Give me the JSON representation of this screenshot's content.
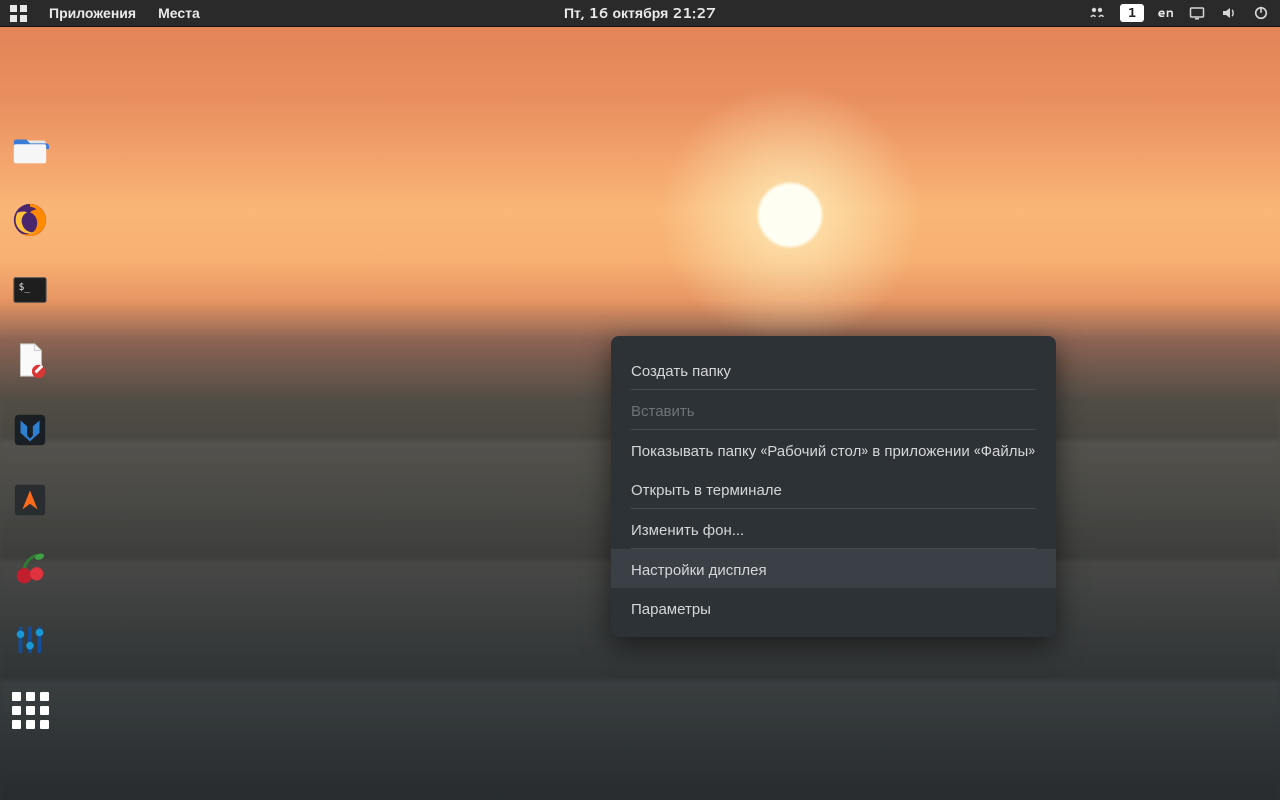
{
  "topbar": {
    "applications": "Приложения",
    "places": "Места",
    "datetime": "Пт, 16 октября  21:27",
    "workspace": "1",
    "keyboard_layout": "en"
  },
  "dock": {
    "items": [
      {
        "name": "files-app-icon"
      },
      {
        "name": "firefox-icon"
      },
      {
        "name": "terminal-icon"
      },
      {
        "name": "text-editor-icon"
      },
      {
        "name": "metasploit-icon"
      },
      {
        "name": "burpsuite-icon"
      },
      {
        "name": "cherrytree-icon"
      },
      {
        "name": "equalizer-icon"
      },
      {
        "name": "show-apps-icon"
      }
    ]
  },
  "context_menu": {
    "items": [
      {
        "label": "Создать папку",
        "enabled": true
      },
      {
        "label": "Вставить",
        "enabled": false
      },
      {
        "label": "Показывать папку «Рабочий стол» в приложении «Файлы»",
        "enabled": true
      },
      {
        "label": "Открыть в терминале",
        "enabled": true
      },
      {
        "label": "Изменить фон…",
        "enabled": true
      },
      {
        "label": "Настройки дисплея",
        "enabled": true,
        "hovered": true
      },
      {
        "label": "Параметры",
        "enabled": true
      }
    ]
  }
}
